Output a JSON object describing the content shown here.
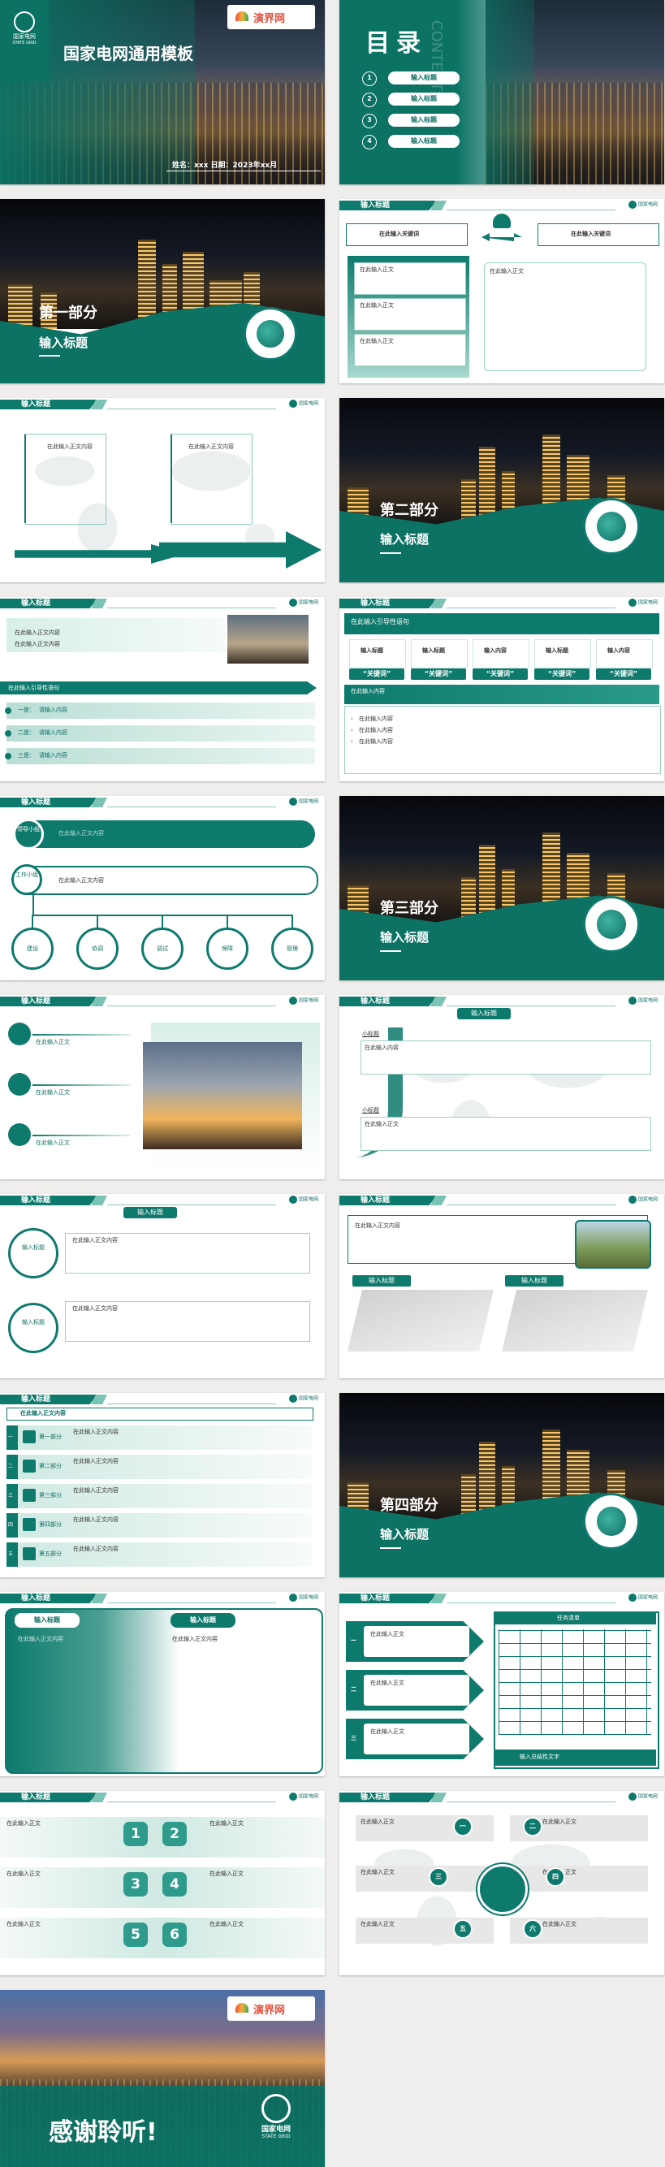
{
  "brand": {
    "name_cn": "国家电网",
    "name_en": "STATE GRID",
    "partner": "演界网"
  },
  "colors": {
    "primary": "#0d7a6d",
    "light": "#d8efe9"
  },
  "cover": {
    "title": "国家电网通用模板",
    "meta": "姓名：xxx    日期：2023年xx月"
  },
  "toc": {
    "title": "目录",
    "watermark": "CONTENTS",
    "items": [
      {
        "n": "1",
        "label": "输入标题"
      },
      {
        "n": "2",
        "label": "输入标题"
      },
      {
        "n": "3",
        "label": "输入标题"
      },
      {
        "n": "4",
        "label": "输入标题"
      }
    ]
  },
  "header_title": "输入标题",
  "sections": [
    {
      "part": "第一部分",
      "title": "输入标题"
    },
    {
      "part": "第二部分",
      "title": "输入标题"
    },
    {
      "part": "第三部分",
      "title": "输入标题"
    },
    {
      "part": "第四部分",
      "title": "输入标题"
    }
  ],
  "s2": {
    "kw_left": "在此输入关键词",
    "kw_right": "在此输入关键词",
    "items": [
      "在此输入正文",
      "在此输入正文",
      "在此输入正文"
    ],
    "body": "在此输入正文"
  },
  "s3": {
    "texts": [
      "在此输入正文内容",
      "在此输入正文内容"
    ]
  },
  "s5": {
    "lines": [
      "在此输入正文内容",
      "在此输入正文内容"
    ],
    "guide": "在此输入引导性语句",
    "rows": [
      {
        "k": "一是：",
        "v": "请输入内容"
      },
      {
        "k": "二是：",
        "v": "请输入内容"
      },
      {
        "k": "三是：",
        "v": "请输入内容"
      }
    ]
  },
  "s6": {
    "guide": "在此输入引导性语句",
    "cards": [
      {
        "t": "输入标题",
        "k": "“关键词”"
      },
      {
        "t": "输入标题",
        "k": "“关键词”"
      },
      {
        "t": "输入内容",
        "k": "“关键词”"
      },
      {
        "t": "输入标题",
        "k": "“关键词”"
      },
      {
        "t": "输入内容",
        "k": "“关键词”"
      }
    ],
    "sub": "在此输入内容",
    "bullets": [
      "在此输入内容",
      "在此输入内容",
      "在此输入内容"
    ]
  },
  "s7": {
    "top_label": "领导小组",
    "top_text": "在此输入正文内容",
    "mid_label": "工作小组",
    "mid_text": "在此输入正文内容",
    "leaves": [
      "建设",
      "协调",
      "调试",
      "保障",
      "管理"
    ]
  },
  "s9": {
    "items": [
      "在此输入正文",
      "在此输入正文",
      "在此输入正文"
    ]
  },
  "s10": {
    "tag": "输入标题",
    "blocks": [
      {
        "t": "小标题",
        "v": "在此输入内容"
      },
      {
        "t": "小标题",
        "v": "在此输入正文"
      }
    ]
  },
  "s11": {
    "tag": "输入标题",
    "items": [
      {
        "c": "输入标题",
        "v": "在此输入正文内容"
      },
      {
        "c": "输入标题",
        "v": "在此输入正文内容"
      }
    ]
  },
  "s12": {
    "text": "在此输入正文内容",
    "tags": [
      "输入标题",
      "输入标题"
    ]
  },
  "s13": {
    "head": "在此输入正文内容",
    "rows": [
      {
        "p": "第一部分",
        "v": "在此输入正文内容"
      },
      {
        "p": "第二部分",
        "v": "在此输入正文内容"
      },
      {
        "p": "第三部分",
        "v": "在此输入正文内容"
      },
      {
        "p": "第四部分",
        "v": "在此输入正文内容"
      },
      {
        "p": "第五部分",
        "v": "在此输入正文内容"
      }
    ],
    "nums": [
      "一",
      "二",
      "三",
      "四",
      "五"
    ]
  },
  "s15": {
    "left_title": "输入标题",
    "left_text": "在此输入正文内容",
    "right_title": "输入标题",
    "right_text": "在此输入正文内容"
  },
  "s16": {
    "items": [
      {
        "n": "一",
        "v": "在此输入正文"
      },
      {
        "n": "二",
        "v": "在此输入正文"
      },
      {
        "n": "三",
        "v": "在此输入正文"
      }
    ],
    "table_title": "任务清单",
    "footer": "输入总结性文字"
  },
  "s17": {
    "left": [
      "在此输入正文",
      "在此输入正文",
      "在此输入正文"
    ],
    "right": [
      "在此输入正文",
      "在此输入正文",
      "在此输入正文"
    ],
    "tiles": [
      "1",
      "2",
      "3",
      "4",
      "5",
      "6"
    ]
  },
  "s18": {
    "nums": [
      "一",
      "二",
      "三",
      "四",
      "五",
      "六"
    ],
    "texts": [
      "在此输入正文",
      "在此输入正文",
      "在此输入正文",
      "在此输入正文",
      "在此输入正文",
      "在此输入正文"
    ]
  },
  "end": {
    "title": "感谢聆听!"
  }
}
